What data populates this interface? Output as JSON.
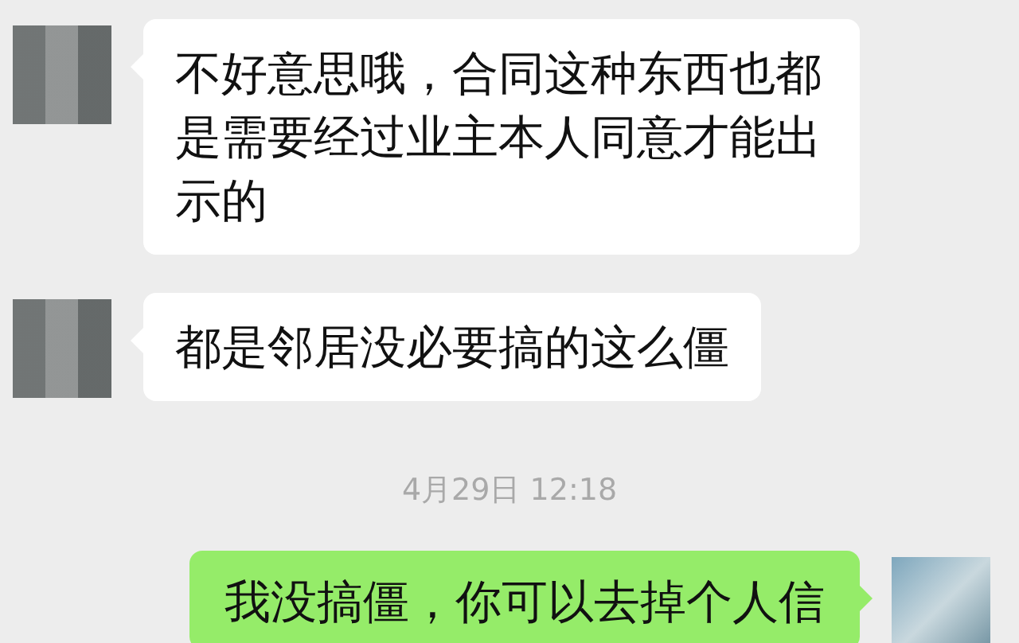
{
  "messages": [
    {
      "kind": "message",
      "outgoing": false,
      "text": "不好意思哦，合同这种东西也都是需要经过业主本人同意才能出示的"
    },
    {
      "kind": "message",
      "outgoing": false,
      "text": "都是邻居没必要搞的这么僵"
    },
    {
      "kind": "time",
      "text": "4月29日 12:18"
    },
    {
      "kind": "message",
      "outgoing": true,
      "text": "我没搞僵，你可以去掉个人信"
    }
  ]
}
